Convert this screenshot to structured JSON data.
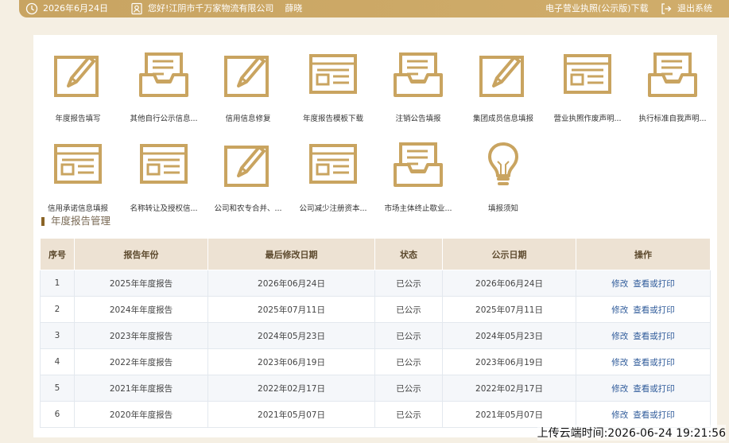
{
  "colors": {
    "gold": "#c9a460",
    "header_bg": "#ede2d3",
    "link": "#2f5b9a"
  },
  "topbar": {
    "date": "2026年6月24日",
    "greeting": "您好!江阴市千万家物流有限公司",
    "username": "薛晓",
    "license_download": "电子营业执照(公示版)下载",
    "logout": "退出系统",
    "icons": {
      "date": "clock-icon",
      "user": "user-icon",
      "logout": "logout-icon"
    }
  },
  "tiles": [
    {
      "label": "年度报告填写",
      "icon": "edit-pencil-icon"
    },
    {
      "label": "其他自行公示信息...",
      "icon": "inbox-tray-icon"
    },
    {
      "label": "信用信息修复",
      "icon": "edit-pencil-icon"
    },
    {
      "label": "年度报告模板下载",
      "icon": "form-template-icon"
    },
    {
      "label": "注销公告填报",
      "icon": "inbox-tray-icon"
    },
    {
      "label": "集团成员信息填报",
      "icon": "edit-pencil-icon"
    },
    {
      "label": "营业执照作废声明...",
      "icon": "form-template-icon"
    },
    {
      "label": "执行标准自我声明...",
      "icon": "inbox-tray-icon"
    },
    {
      "label": "信用承诺信息填报",
      "icon": "form-template-icon"
    },
    {
      "label": "名称转让及授权信...",
      "icon": "form-template-icon"
    },
    {
      "label": "公司和农专合并、...",
      "icon": "edit-pencil-icon"
    },
    {
      "label": "公司减少注册资本...",
      "icon": "form-template-icon"
    },
    {
      "label": "市场主体终止歇业...",
      "icon": "inbox-tray-icon"
    },
    {
      "label": "填报须知",
      "icon": "lightbulb-icon"
    }
  ],
  "section_title": "年度报告管理",
  "table": {
    "headers": [
      "序号",
      "报告年份",
      "最后修改日期",
      "状态",
      "公示日期",
      "操作"
    ],
    "rows": [
      {
        "no": "1",
        "year": "2025年年度报告",
        "modified": "2026年06月24日",
        "status": "已公示",
        "published": "2026年06月24日",
        "edit": "修改",
        "view": "查看或打印"
      },
      {
        "no": "2",
        "year": "2024年年度报告",
        "modified": "2025年07月11日",
        "status": "已公示",
        "published": "2025年07月11日",
        "edit": "修改",
        "view": "查看或打印"
      },
      {
        "no": "3",
        "year": "2023年年度报告",
        "modified": "2024年05月23日",
        "status": "已公示",
        "published": "2024年05月23日",
        "edit": "修改",
        "view": "查看或打印"
      },
      {
        "no": "4",
        "year": "2022年年度报告",
        "modified": "2023年06月19日",
        "status": "已公示",
        "published": "2023年06月19日",
        "edit": "修改",
        "view": "查看或打印"
      },
      {
        "no": "5",
        "year": "2021年年度报告",
        "modified": "2022年02月17日",
        "status": "已公示",
        "published": "2022年02月17日",
        "edit": "修改",
        "view": "查看或打印"
      },
      {
        "no": "6",
        "year": "2020年年度报告",
        "modified": "2021年05月07日",
        "status": "已公示",
        "published": "2021年05月07日",
        "edit": "修改",
        "view": "查看或打印"
      }
    ]
  },
  "watermark": "上传云端时间:2026-06-24 19:21:56"
}
